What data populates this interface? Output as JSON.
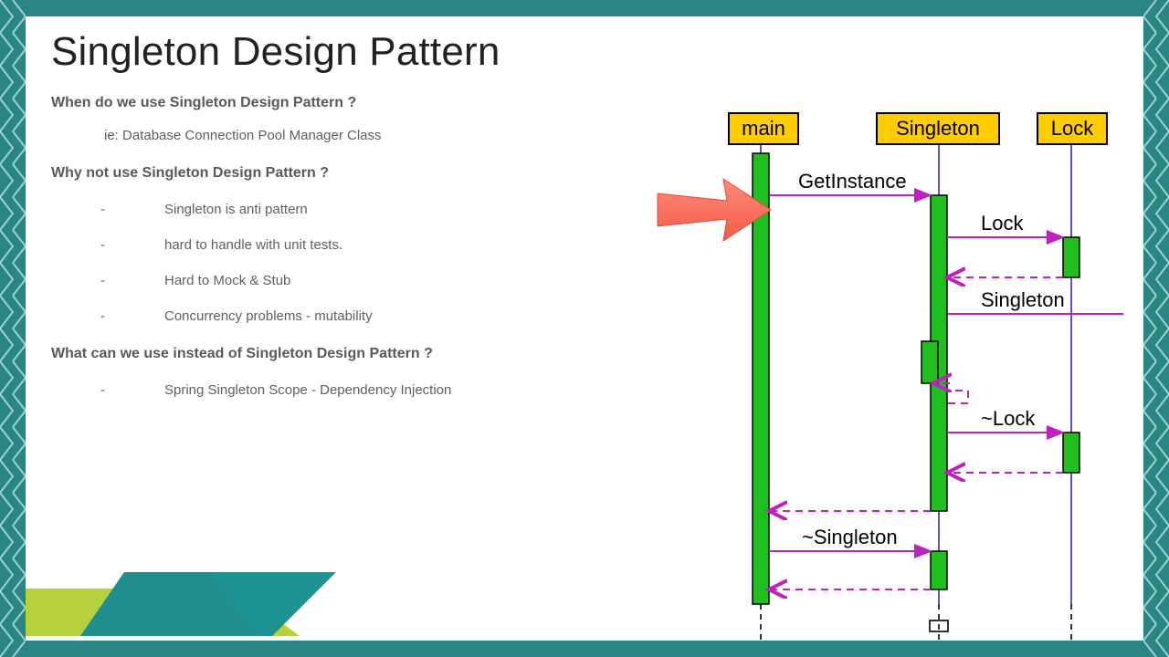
{
  "title": "Singleton Design Pattern",
  "text": {
    "q1": "When do we use Singleton Design Pattern ?",
    "ie": "ie: Database Connection Pool Manager Class",
    "q2": "Why not use Singleton Design Pattern ?",
    "bullets": [
      "Singleton is anti pattern",
      "hard to handle with unit tests.",
      "Hard to Mock & Stub",
      "Concurrency problems - mutability"
    ],
    "q3": "What can we use instead of Singleton Design Pattern ?",
    "alt": "Spring Singleton Scope - Dependency Injection"
  },
  "diagram": {
    "participants": [
      "main",
      "Singleton",
      "Lock"
    ],
    "messages": [
      "GetInstance",
      "Lock",
      "Singleton",
      "~Lock",
      "~Singleton"
    ]
  }
}
